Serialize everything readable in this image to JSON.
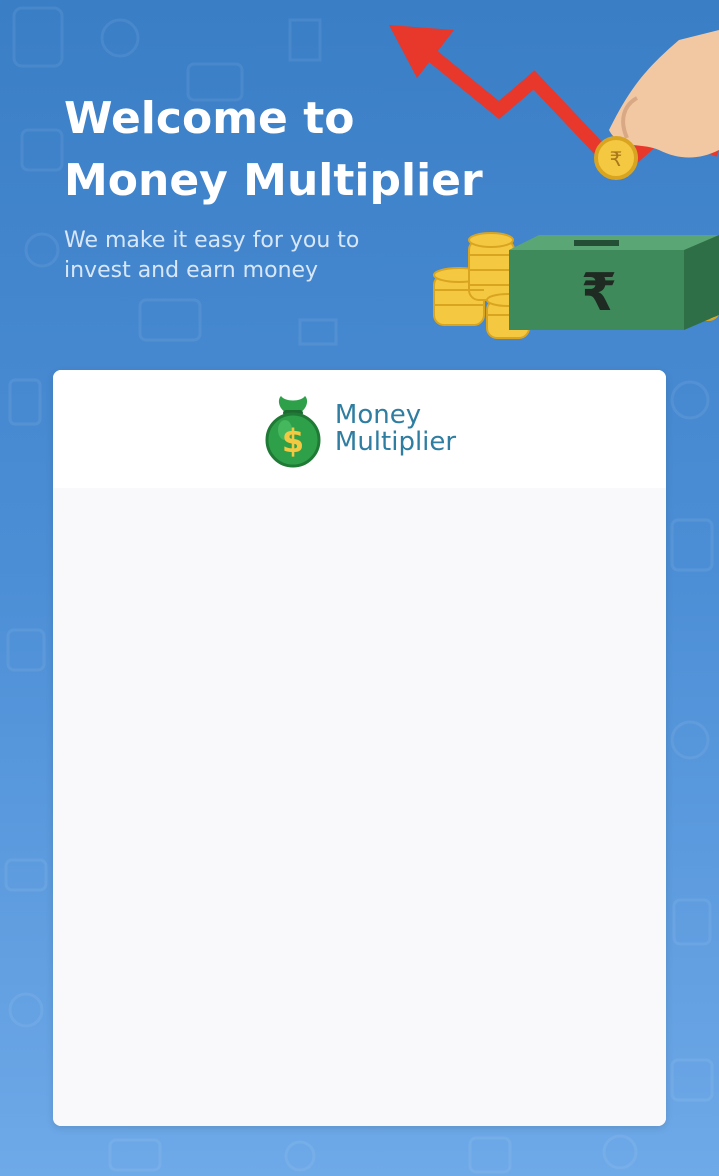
{
  "hero": {
    "title": "Welcome to Money Multiplier",
    "subtitle": "We make it easy for you to invest and earn money"
  },
  "brand": {
    "name_line1": "Money",
    "name_line2": "Multiplier",
    "logo_icon": "money-bag-icon",
    "currency_symbol": "$"
  },
  "illustration": {
    "icons": [
      "trend-arrow-icon",
      "hand-coin-icon",
      "coin-stack-icon",
      "money-box-icon"
    ],
    "currency_symbol": "₹"
  },
  "colors": {
    "background_top": "#3a7ec6",
    "background_bottom": "#6ea9e8",
    "brand_text": "#2f7ea2",
    "arrow": "#e8372b",
    "coin": "#f5c842",
    "money_box": "#3f8a5a",
    "bag": "#2fa04a"
  }
}
